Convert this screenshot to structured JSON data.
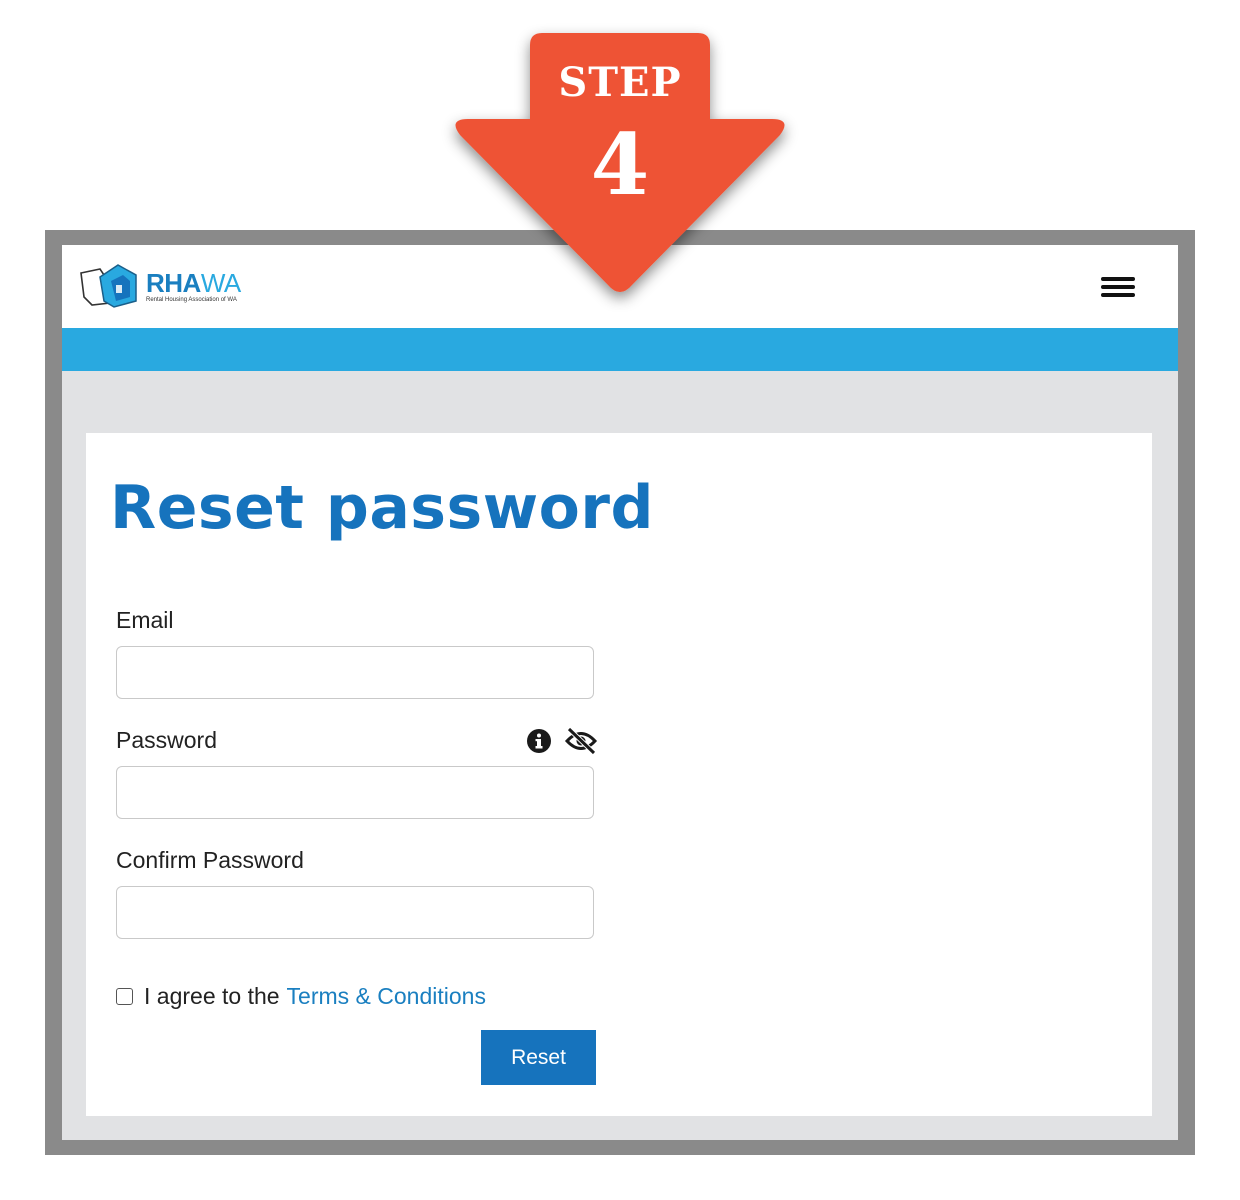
{
  "step": {
    "word": "STEP",
    "number": "4",
    "color": "#ee5235"
  },
  "header": {
    "logo_main_a": "RHA",
    "logo_main_b": "WA",
    "logo_sub": "Rental Housing Association of WA",
    "menu_icon": "hamburger-icon"
  },
  "colors": {
    "brand_blue": "#1673bd",
    "bar_blue": "#29a9e0",
    "page_gray": "#e1e2e4"
  },
  "form": {
    "title": "Reset password",
    "email_label": "Email",
    "email_value": "",
    "password_label": "Password",
    "password_value": "",
    "password_icons": [
      "info-icon",
      "eye-slash-icon"
    ],
    "confirm_label": "Confirm Password",
    "confirm_value": "",
    "agree_text": "I agree to the",
    "terms_link": "Terms & Conditions",
    "agree_checked": false,
    "reset_button": "Reset"
  }
}
